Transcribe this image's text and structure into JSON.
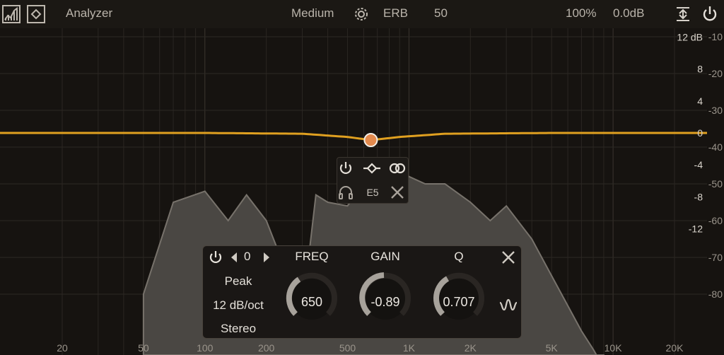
{
  "topbar": {
    "analyzer_label": "Analyzer",
    "resolution": "Medium",
    "scale_mode": "ERB",
    "range_value": "50",
    "zoom": "100%",
    "output_gain": "0.0dB",
    "icons": [
      "analyzer-mode-icon",
      "display-mode-icon",
      "gear-icon",
      "collapse-icon",
      "power-icon"
    ]
  },
  "axes": {
    "freq_labels": [
      "20",
      "50",
      "100",
      "200",
      "500",
      "1K",
      "2K",
      "5K",
      "10K",
      "20K"
    ],
    "gain_labels": [
      "12 dB",
      "8",
      "4",
      "0",
      "-4",
      "-8",
      "-12"
    ],
    "analyzer_labels": [
      "-10",
      "-20",
      "-30",
      "-40",
      "-50",
      "-60",
      "-70",
      "-80"
    ]
  },
  "band_popup": {
    "note": "E5",
    "icons": [
      "power-icon",
      "filter-type-icon",
      "stereo-link-icon",
      "headphones-icon",
      "close-icon"
    ]
  },
  "band_panel": {
    "band_number": "0",
    "filter_type": "Peak",
    "slope": "12 dB/oct",
    "channel": "Stereo",
    "freq_label": "FREQ",
    "freq_value": "650",
    "gain_label": "GAIN",
    "gain_value": "-0.89",
    "q_label": "Q",
    "q_value": "0.707"
  },
  "chart_data": {
    "type": "line",
    "title": "",
    "xlabel": "",
    "ylabel": "",
    "x_scale": "log",
    "xlim": [
      20,
      20000
    ],
    "ylim": [
      -12,
      12
    ],
    "grid": true,
    "series": [
      {
        "x": [
          20,
          100,
          300,
          500,
          650,
          900,
          1500,
          5000,
          20000
        ],
        "values": [
          0,
          0,
          -0.1,
          -0.5,
          -0.89,
          -0.5,
          -0.1,
          0,
          0
        ]
      }
    ],
    "analyzer_spectrum_db": {
      "x": [
        50,
        70,
        100,
        130,
        160,
        200,
        300,
        350,
        400,
        500,
        600,
        700,
        800,
        1000,
        1200,
        1500,
        2000,
        2500,
        3000,
        4000,
        5000,
        7000,
        8000,
        9000
      ],
      "values": [
        -80,
        -55,
        -52,
        -60,
        -53,
        -60,
        -85,
        -53,
        -55,
        -56,
        -50,
        -52,
        -50,
        -48,
        -50,
        -50,
        -55,
        -60,
        -56,
        -65,
        -75,
        -90,
        -95,
        -100
      ]
    },
    "colors": {
      "eq_curve": "#e0a020",
      "band_point": "#e38a4e",
      "spectrum_fill": "#4b4844"
    }
  }
}
